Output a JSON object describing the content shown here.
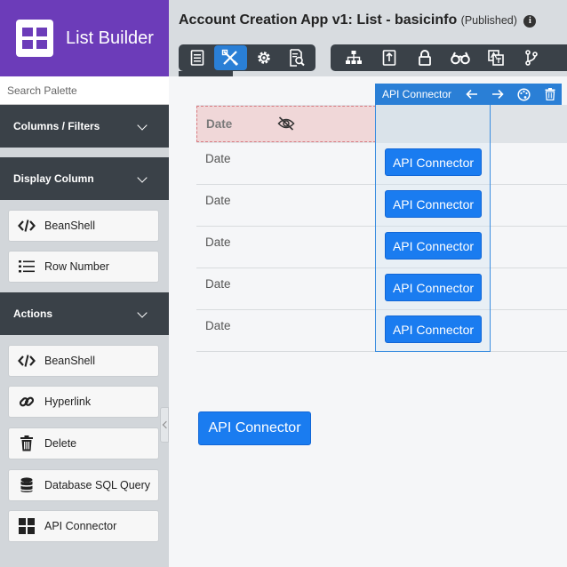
{
  "brand": {
    "title": "List Builder",
    "logo_icon": "grid-logo-icon"
  },
  "palette": {
    "search_placeholder": "Search Palette",
    "sections": [
      {
        "title": "Columns / Filters",
        "items": []
      },
      {
        "title": "Display Column",
        "items": [
          {
            "label": "BeanShell",
            "icon": "code-icon"
          },
          {
            "label": "Row Number",
            "icon": "numbered-list-icon"
          }
        ]
      },
      {
        "title": "Actions",
        "items": [
          {
            "label": "BeanShell",
            "icon": "code-icon"
          },
          {
            "label": "Hyperlink",
            "icon": "link-icon"
          },
          {
            "label": "Delete",
            "icon": "trash-icon"
          },
          {
            "label": "Database SQL Query",
            "icon": "database-icon"
          },
          {
            "label": "API Connector",
            "icon": "windows-grid-icon"
          }
        ]
      }
    ]
  },
  "header": {
    "title": "Account Creation App v1: List - basicinfo",
    "status": "(Published)",
    "toolbar_left": [
      "list-icon",
      "design-tools-icon",
      "gear-icon",
      "search-document-icon"
    ],
    "toolbar_left_active": 1,
    "toolbar_right": [
      "sitemap-icon",
      "file-export-icon",
      "lock-icon",
      "binoculars-icon",
      "translate-icon",
      "branch-icon"
    ]
  },
  "grid": {
    "header": {
      "label": "Date",
      "hidden_icon": "eye-slash-icon"
    },
    "rows": [
      {
        "date": "Date",
        "action": "API Connector"
      },
      {
        "date": "Date",
        "action": "API Connector"
      },
      {
        "date": "Date",
        "action": "API Connector"
      },
      {
        "date": "Date",
        "action": "API Connector"
      },
      {
        "date": "Date",
        "action": "API Connector"
      }
    ],
    "column_toolbar": {
      "label": "API Connector",
      "icons": [
        "arrow-left-icon",
        "arrow-right-icon",
        "palette-icon",
        "trash-icon"
      ]
    }
  },
  "bulk_action": {
    "label": "API Connector"
  },
  "colors": {
    "brand": "#6c3cb9",
    "accent": "#1a7cf0",
    "dark": "#3a4148",
    "highlight": "#f0d7d8"
  }
}
